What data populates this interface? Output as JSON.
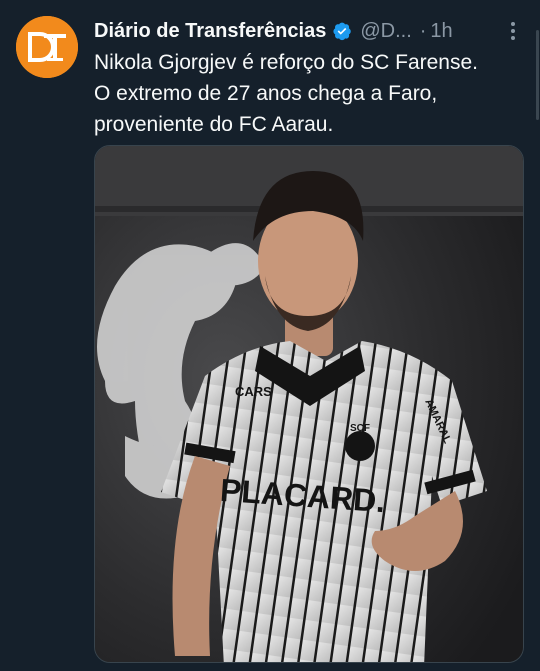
{
  "tweet": {
    "author_name": "Diário de Transferências",
    "handle": "@D...",
    "separator": "·",
    "time": "1h",
    "text_lines": [
      "Nikola Gjorgjev é reforço do SC Farense.",
      "O extremo de 27 anos chega a Faro,",
      "proveniente do FC Aarau."
    ],
    "avatar_logo": "DT",
    "icons": {
      "verified": "verified-badge-icon",
      "more": "more-options-icon"
    },
    "colors": {
      "background": "#15202b",
      "avatar": "#f28a1c",
      "verified": "#1d9bf0",
      "secondary_text": "#8b98a5"
    }
  },
  "media": {
    "jersey_texts": [
      "CARS",
      "PLACARD.",
      "SCF",
      "AMARAL"
    ]
  }
}
